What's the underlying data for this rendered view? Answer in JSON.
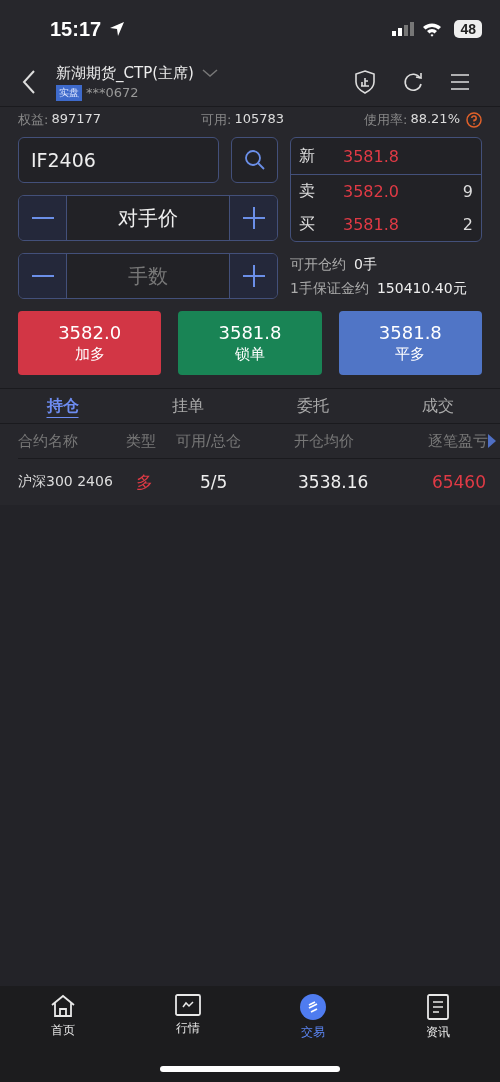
{
  "status_bar": {
    "time": "15:17",
    "battery": "48"
  },
  "header": {
    "title": "新湖期货_CTP(主席)",
    "account_tag": "实盘",
    "account": "***0672"
  },
  "summary": [
    {
      "label": "权益:",
      "value": "897177"
    },
    {
      "label": "可用:",
      "value": "105783"
    },
    {
      "label": "使用率:",
      "value": "88.21%"
    }
  ],
  "symbol_field": {
    "value": "IF2406"
  },
  "price_stepper": {
    "value": "对手价"
  },
  "quantity_stepper": {
    "placeholder": "手数"
  },
  "quote": [
    {
      "label": "新",
      "price": "3581.8"
    },
    {
      "label": "卖",
      "price": "3582.0",
      "volume": "9"
    },
    {
      "label": "买",
      "price": "3581.8",
      "volume": "2"
    }
  ],
  "openable": {
    "label": "可开仓约",
    "value": "0手"
  },
  "margin": {
    "label": "1手保证金约",
    "value": "150410.40元"
  },
  "actions": [
    {
      "kind": "buy",
      "price": "3582.0",
      "label": "加多"
    },
    {
      "kind": "lock",
      "price": "3581.8",
      "label": "锁单"
    },
    {
      "kind": "close",
      "price": "3581.8",
      "label": "平多"
    }
  ],
  "tabs": [
    {
      "label": "持仓",
      "selected": true
    },
    {
      "label": "挂单",
      "selected": false
    },
    {
      "label": "委托",
      "selected": false
    },
    {
      "label": "成交",
      "selected": false
    }
  ],
  "table": {
    "columns": [
      "合约名称",
      "类型",
      "可用/总仓",
      "开仓均价",
      "逐笔盈亏"
    ],
    "rows": [
      [
        "沪深300 2406",
        "多",
        "5/5",
        "3538.16",
        "65460"
      ]
    ]
  },
  "bottom_nav": [
    {
      "label": "首页",
      "kind": "home",
      "selected": false
    },
    {
      "label": "行情",
      "kind": "chart",
      "selected": false
    },
    {
      "label": "交易",
      "kind": "trade",
      "selected": true
    },
    {
      "label": "资讯",
      "kind": "news",
      "selected": false
    }
  ]
}
